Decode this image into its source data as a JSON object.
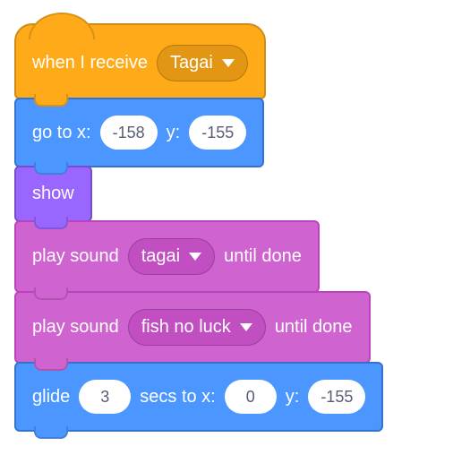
{
  "blocks": {
    "receive": {
      "label": "when I receive",
      "message": "Tagai"
    },
    "goto": {
      "prefix": "go to x:",
      "x": "-158",
      "mid": "y:",
      "y": "-155"
    },
    "show": {
      "label": "show"
    },
    "sound1": {
      "prefix": "play sound",
      "clip": "tagai",
      "suffix": "until done"
    },
    "sound2": {
      "prefix": "play sound",
      "clip": "fish no luck",
      "suffix": "until done"
    },
    "glide": {
      "prefix": "glide",
      "secs": "3",
      "mid1": "secs to x:",
      "x": "0",
      "mid2": "y:",
      "y": "-155"
    }
  }
}
